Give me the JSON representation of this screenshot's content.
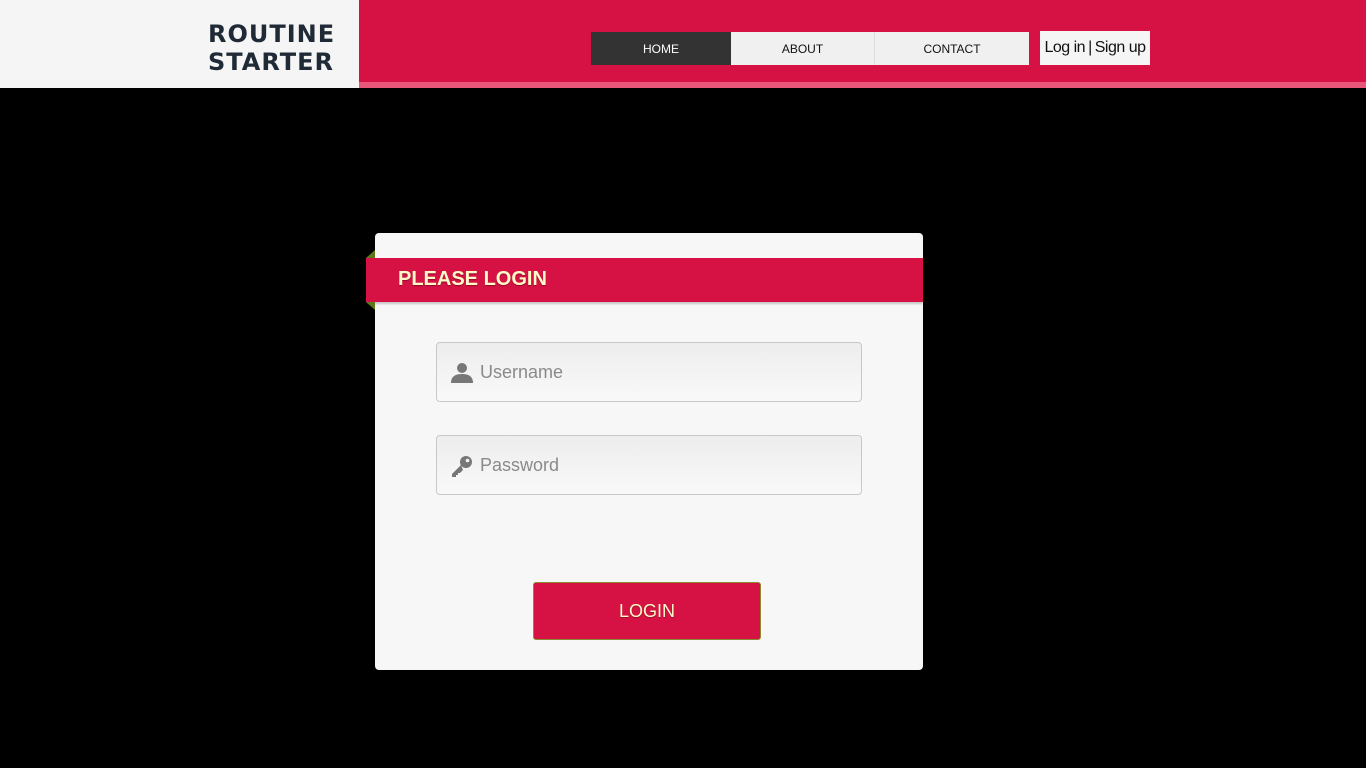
{
  "brand": {
    "line1": "ROUTINE",
    "line2": "STARTER"
  },
  "nav": {
    "home": "HOME",
    "about": "ABOUT",
    "contact": "CONTACT",
    "active": "HOME"
  },
  "auth": {
    "login": "Log in",
    "separator": "|",
    "signup": "Sign up"
  },
  "login_form": {
    "title": "PLEASE LOGIN",
    "username_placeholder": "Username",
    "password_placeholder": "Password",
    "submit_label": "LOGIN"
  },
  "icons": {
    "username": "user-icon",
    "password": "key-icon"
  },
  "colors": {
    "brand_red": "#d61244",
    "nav_active": "#333333",
    "button_text": "#fff9c8"
  }
}
